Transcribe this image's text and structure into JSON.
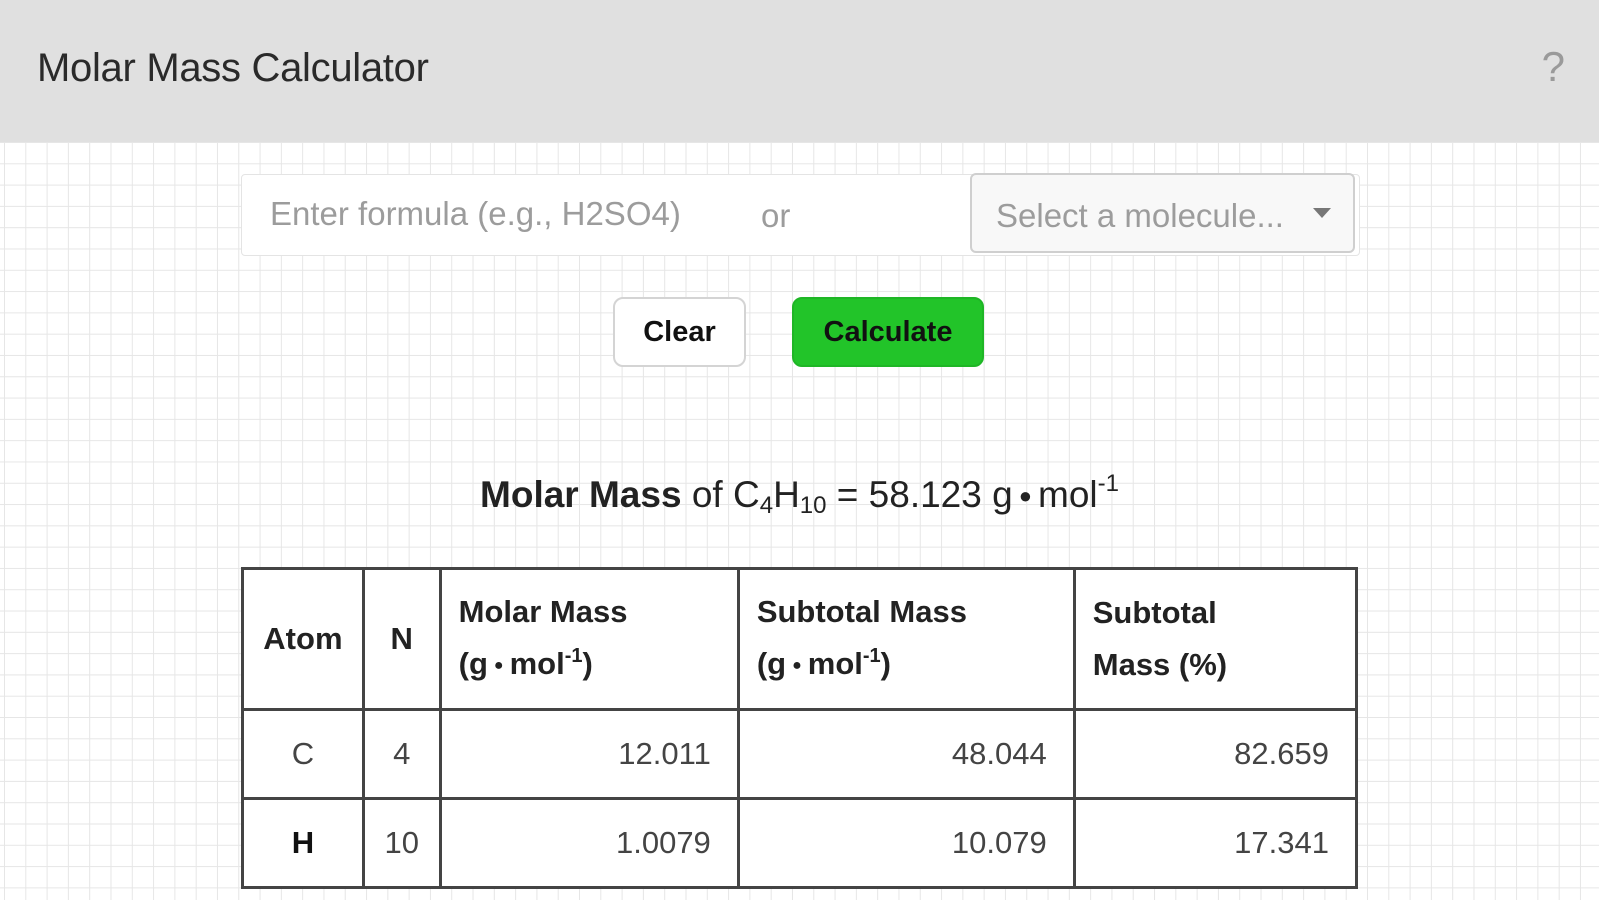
{
  "header": {
    "title": "Molar Mass Calculator",
    "help_label": "?"
  },
  "form": {
    "formula_placeholder": "Enter formula (e.g., H2SO4)",
    "formula_value": "",
    "or_label": "or",
    "molecule_select_label": "Select a molecule...",
    "clear_label": "Clear",
    "calculate_label": "Calculate",
    "calculate_color": "#22c429"
  },
  "result": {
    "label": "Molar Mass",
    "of_text": "of",
    "formula_parts": [
      {
        "symbol": "C",
        "count": "4"
      },
      {
        "symbol": "H",
        "count": "10"
      }
    ],
    "equals": "=",
    "value": "58.123",
    "unit": "g",
    "unit_denominator": "mol",
    "unit_exponent": "-1"
  },
  "table": {
    "headers": {
      "atom": "Atom",
      "n": "N",
      "molar_mass_line1": "Molar Mass",
      "molar_mass_line2": "(g",
      "molar_mass_unit": "mol",
      "subtotal_mass_line1": "Subtotal Mass",
      "subtotal_mass_line2": "(g",
      "subtotal_mass_unit": "mol",
      "exponent": "-1",
      "close_paren": ")",
      "subtotal_pct_line1": "Subtotal",
      "subtotal_pct_line2": "Mass (%)"
    },
    "rows": [
      {
        "atom": "C",
        "n": "4",
        "molar_mass": "12.011",
        "subtotal_mass": "48.044",
        "subtotal_pct": "82.659"
      },
      {
        "atom": "H",
        "n": "10",
        "molar_mass": "1.0079",
        "subtotal_mass": "10.079",
        "subtotal_pct": "17.341"
      }
    ]
  }
}
